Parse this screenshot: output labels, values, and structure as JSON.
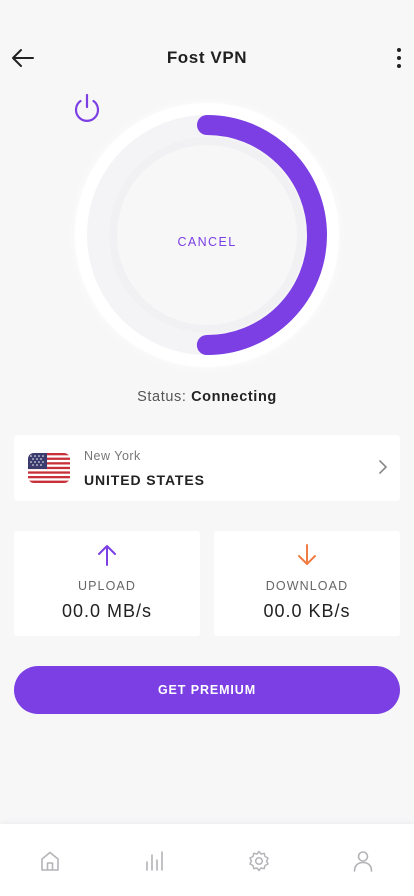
{
  "app": {
    "title": "Fost VPN"
  },
  "colors": {
    "accent": "#7b3fe4",
    "download_arrow": "#f07c45",
    "background": "#f7f7f8"
  },
  "connection": {
    "action_label": "CANCEL",
    "status_label": "Status:",
    "status_value": "Connecting",
    "progress": 0.5
  },
  "location": {
    "city": "New York",
    "country": "UNITED STATES",
    "flag": "us-flag"
  },
  "stats": {
    "upload": {
      "label": "UPLOAD",
      "value": "00.0 MB/s",
      "icon": "arrow-up-icon"
    },
    "download": {
      "label": "DOWNLOAD",
      "value": "00.0 KB/s",
      "icon": "arrow-down-icon"
    }
  },
  "premium_button": {
    "label": "GET PREMIUM"
  },
  "tabbar": {
    "items": [
      {
        "icon": "home-icon"
      },
      {
        "icon": "bar-chart-icon"
      },
      {
        "icon": "gear-icon"
      },
      {
        "icon": "user-icon"
      }
    ]
  }
}
